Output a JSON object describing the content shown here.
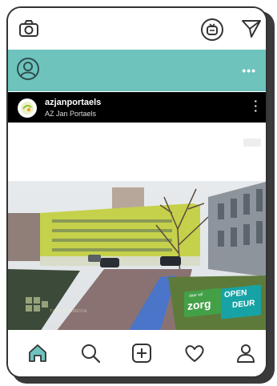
{
  "post": {
    "username": "azjanportaels",
    "subtitle": "AZ Jan Portaels"
  },
  "badge": {
    "line1": "daar wil",
    "line2": "zorg",
    "open": "OPEN",
    "deur": "DEUR"
  },
  "watermark": "TUBANTIAMEDIA",
  "icons": {
    "camera": "camera-icon",
    "igtv": "igtv-icon",
    "send": "send-icon",
    "profile": "profile-icon",
    "more": "more-icon",
    "home": "home-icon",
    "search": "search-icon",
    "add": "add-post-icon",
    "heart": "heart-icon",
    "account": "account-icon"
  },
  "colors": {
    "profile_bar": "#6ec3bd",
    "building": "#c5d14b",
    "badge_green": "#4caf50",
    "badge_teal": "#17a3a5"
  }
}
